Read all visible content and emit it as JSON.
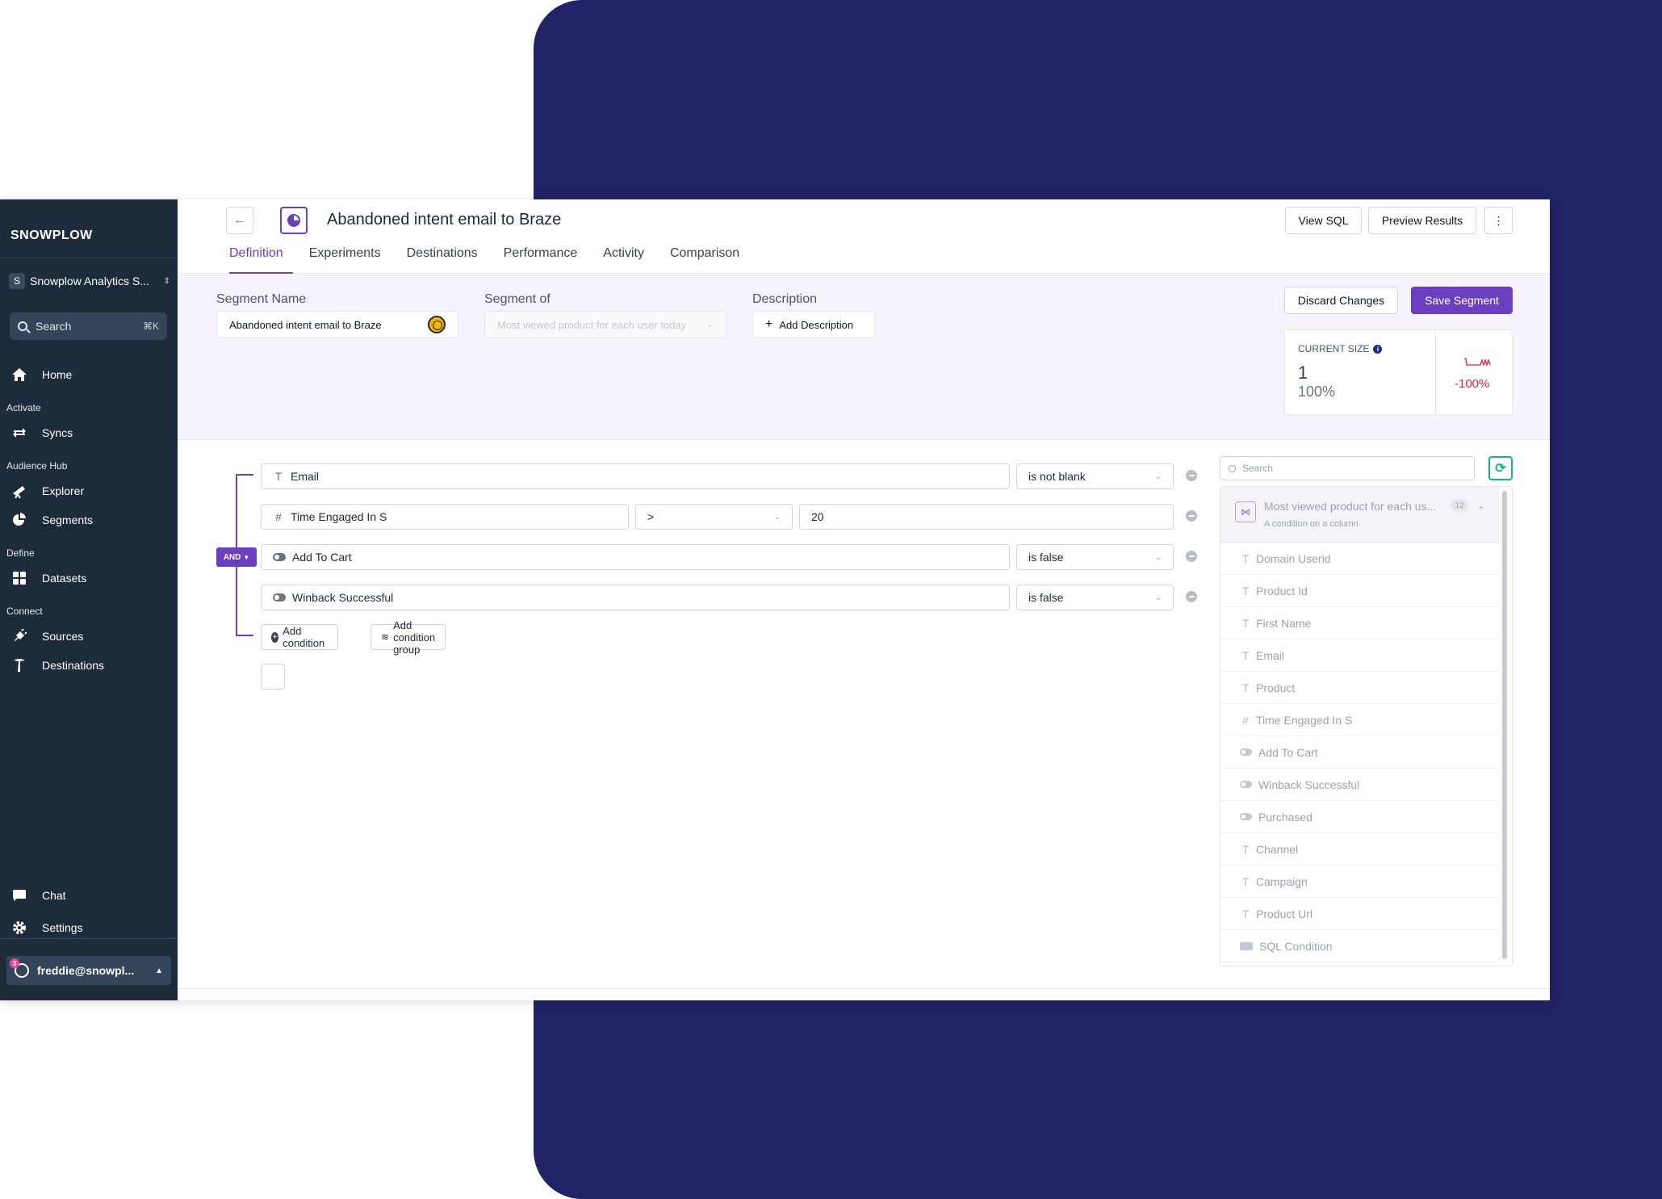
{
  "sidebar": {
    "logo": "SNOWPLOW",
    "org_initial": "S",
    "org_name": "Snowplow Analytics S...",
    "search_label": "Search",
    "search_shortcut": "⌘K",
    "items": {
      "home": "Home",
      "group_activate": "Activate",
      "syncs": "Syncs",
      "group_audience": "Audience Hub",
      "explorer": "Explorer",
      "segments": "Segments",
      "group_define": "Define",
      "datasets": "Datasets",
      "group_connect": "Connect",
      "sources": "Sources",
      "destinations": "Destinations",
      "chat": "Chat",
      "settings": "Settings"
    },
    "user": {
      "name": "freddie@snowpl...",
      "badge": "3"
    }
  },
  "header": {
    "title": "Abandoned intent email to Braze",
    "view_sql": "View SQL",
    "preview_results": "Preview Results",
    "more": "⋮",
    "tabs": [
      "Definition",
      "Experiments",
      "Destinations",
      "Performance",
      "Activity",
      "Comparison"
    ]
  },
  "definition": {
    "segment_name_label": "Segment Name",
    "segment_name_value": "Abandoned intent email to Braze",
    "segment_of_label": "Segment of",
    "segment_of_placeholder": "Most viewed product for each user today",
    "description_label": "Description",
    "add_description": "Add Description",
    "discard": "Discard Changes",
    "save": "Save Segment",
    "current_size_label": "CURRENT SIZE",
    "current_size_value": "1",
    "current_size_pct": "100%",
    "delta": "-100%"
  },
  "builder": {
    "operator": "AND",
    "conditions": [
      {
        "field": "Email",
        "op": "is not blank"
      },
      {
        "field": "Time Engaged In S",
        "op": ">",
        "value": "20"
      },
      {
        "field": "Add To Cart",
        "op": "is false"
      },
      {
        "field": "Winback Successful",
        "op": "is false"
      }
    ],
    "add_condition": "Add condition",
    "add_condition_group": "Add condition group"
  },
  "columns_panel": {
    "search_placeholder": "Search",
    "header_title": "Most viewed product for each us...",
    "header_count": "12",
    "header_subtitle": "A condition on a column",
    "items": [
      "Domain Userid",
      "Product Id",
      "First Name",
      "Email",
      "Product",
      "Time Engaged In S",
      "Add To Cart",
      "Winback Successful",
      "Purchased",
      "Channel",
      "Campaign",
      "Product Url",
      "SQL Condition"
    ]
  },
  "colors": {
    "brand": "#6b3fbf",
    "navy": "#222266",
    "sidebar": "#1e2b3a",
    "negative": "#e11d48",
    "refresh": "#10b981"
  }
}
